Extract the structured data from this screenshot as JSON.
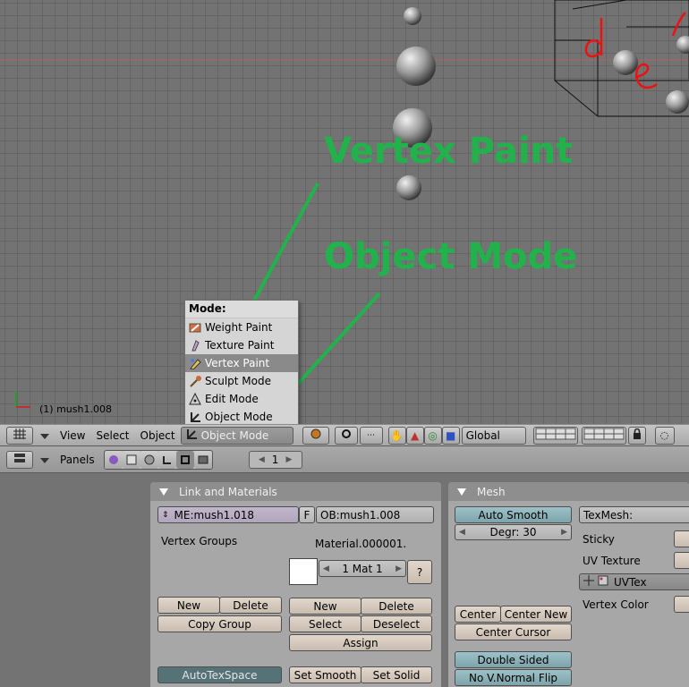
{
  "viewport": {
    "object_label": "(1) mush1.008",
    "annotation_vertex_paint": "Vertex Paint",
    "annotation_object_mode": "Object Mode",
    "annotation_color": "#22b24c"
  },
  "mode_menu": {
    "title": "Mode:",
    "items": [
      {
        "label": "Weight Paint",
        "icon": "weight-paint-icon"
      },
      {
        "label": "Texture Paint",
        "icon": "texture-paint-icon"
      },
      {
        "label": "Vertex Paint",
        "icon": "vertex-paint-icon"
      },
      {
        "label": "Sculpt Mode",
        "icon": "sculpt-mode-icon"
      },
      {
        "label": "Edit Mode",
        "icon": "edit-mode-icon"
      },
      {
        "label": "Object Mode",
        "icon": "object-mode-icon"
      }
    ],
    "highlighted": "Vertex Paint"
  },
  "view_header": {
    "menus": [
      "View",
      "Select",
      "Object"
    ],
    "mode_selector": "Object Mode",
    "orientation": "Global"
  },
  "buttons_header": {
    "panels_label": "Panels",
    "frame": "1"
  },
  "link_materials": {
    "title": "Link and Materials",
    "mesh_name": "ME:mush1.018",
    "fake_user": "F",
    "object_name": "OB:mush1.008",
    "vertex_groups_label": "Vertex Groups",
    "material_label": "Material.000001.",
    "mat_selector": "1 Mat 1",
    "help": "?",
    "new": "New",
    "delete": "Delete",
    "copy_group": "Copy Group",
    "mat_new": "New",
    "mat_delete": "Delete",
    "select": "Select",
    "deselect": "Deselect",
    "assign": "Assign",
    "autotexspace": "AutoTexSpace",
    "set_smooth": "Set Smooth",
    "set_solid": "Set Solid"
  },
  "mesh": {
    "title": "Mesh",
    "auto_smooth": "Auto Smooth",
    "degr": "Degr: 30",
    "center": "Center",
    "center_new": "Center New",
    "center_cursor": "Center Cursor",
    "double_sided": "Double Sided",
    "no_vnormal_flip": "No V.Normal Flip",
    "texmesh": "TexMesh:",
    "sticky": "Sticky",
    "uv_texture": "UV Texture",
    "uvtex": "UVTex",
    "vertex_color": "Vertex Color"
  }
}
